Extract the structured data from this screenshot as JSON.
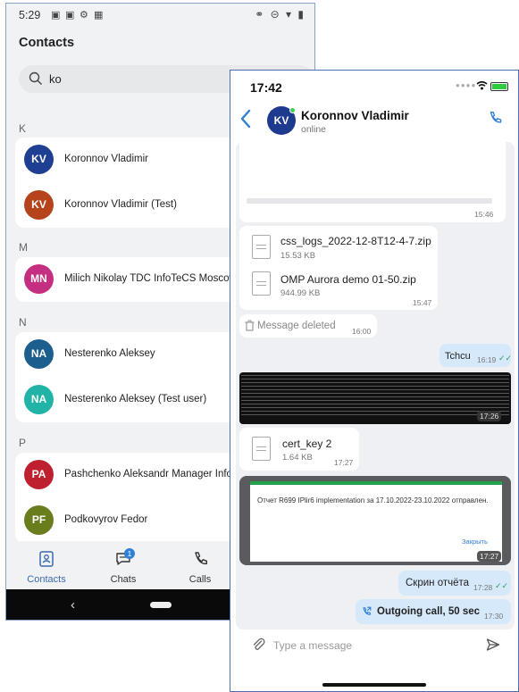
{
  "android": {
    "status": {
      "time": "5:29",
      "icons": [
        "sim-icon",
        "sim-icon",
        "gear-icon",
        "grid-icon"
      ],
      "right_icons": "⚭ ⊝ ▾ ▮"
    },
    "title": "Contacts",
    "search": {
      "value": "ko"
    },
    "sections": [
      {
        "letter": "K",
        "contacts": [
          {
            "initials": "KV",
            "name": "Koronnov Vladimir",
            "color": "#1f3f93"
          },
          {
            "initials": "KV",
            "name": "Koronnov Vladimir (Test)",
            "color": "#b5441c"
          }
        ]
      },
      {
        "letter": "M",
        "contacts": [
          {
            "initials": "MN",
            "name": "Milich Nikolay TDC InfoTeCS Moscow A",
            "color": "#c42f82"
          }
        ]
      },
      {
        "letter": "N",
        "contacts": [
          {
            "initials": "NA",
            "name": "Nesterenko Aleksey",
            "color": "#1c5f8e"
          },
          {
            "initials": "NA",
            "name": "Nesterenko Aleksey (Test user)",
            "color": "#20b3a6"
          }
        ]
      },
      {
        "letter": "P",
        "contacts": [
          {
            "initials": "PA",
            "name": "Pashchenko Aleksandr Manager Infote",
            "color": "#bf2030"
          },
          {
            "initials": "PF",
            "name": "Podkovyrov Fedor",
            "color": "#6a7d1c"
          }
        ]
      }
    ],
    "tabs": [
      {
        "label": "Contacts",
        "icon": "contact-card-icon",
        "active": true
      },
      {
        "label": "Chats",
        "icon": "chat-bubble-icon",
        "active": false,
        "badge": "1"
      },
      {
        "label": "Calls",
        "icon": "phone-icon",
        "active": false
      }
    ]
  },
  "ios": {
    "status": {
      "time": "17:42"
    },
    "header": {
      "initials": "KV",
      "name": "Koronnov Vladimir",
      "status": "online"
    },
    "messages": {
      "m1_time": "15:46",
      "file1": {
        "name": "css_logs_2022-12-8T12-4-7.zip",
        "size": "15.53 KB"
      },
      "file2": {
        "name": "OMP Aurora demo 01-50.zip",
        "size": "944.99 KB",
        "time": "15:47"
      },
      "deleted": {
        "text": "Message deleted",
        "time": "16:00"
      },
      "out1": {
        "text": "Tchcu",
        "time": "16:19"
      },
      "terminal_time": "17:26",
      "file3": {
        "name": "cert_key 2",
        "size": "1.64 KB",
        "time": "17:27"
      },
      "screenshot": {
        "text": "Отчет R699 IPlir6 implementation за 17.10.2022-23.10.2022 отправлен.",
        "close": "Закрыть",
        "time": "17:27"
      },
      "out2": {
        "text": "Скрин отчёта",
        "time": "17:28"
      },
      "call": {
        "text": "Outgoing call, 50 sec",
        "time": "17:30"
      }
    },
    "input": {
      "placeholder": "Type a message"
    }
  }
}
